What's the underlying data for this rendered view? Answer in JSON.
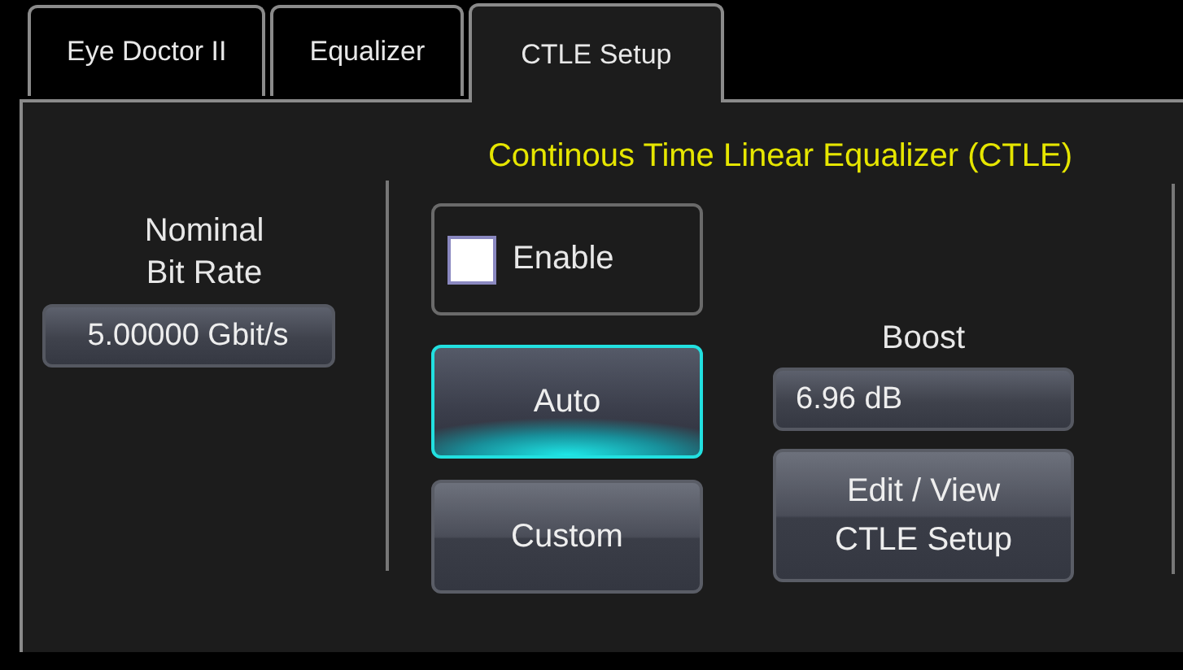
{
  "tabs": [
    {
      "label": "Eye Doctor II",
      "selected": false
    },
    {
      "label": "Equalizer",
      "selected": false
    },
    {
      "label": "CTLE Setup",
      "selected": true
    }
  ],
  "bit_rate": {
    "label": "Nominal Bit Rate",
    "value": "5.00000 Gbit/s"
  },
  "ctle": {
    "title": "Continous Time Linear Equalizer (CTLE)",
    "enable": {
      "label": "Enable",
      "checked": false
    },
    "modes": [
      {
        "label": "Auto",
        "selected": true
      },
      {
        "label": "Custom",
        "selected": false
      }
    ],
    "boost": {
      "label": "Boost",
      "value": "6.96 dB"
    },
    "edit_button": "Edit / View CTLE Setup"
  }
}
